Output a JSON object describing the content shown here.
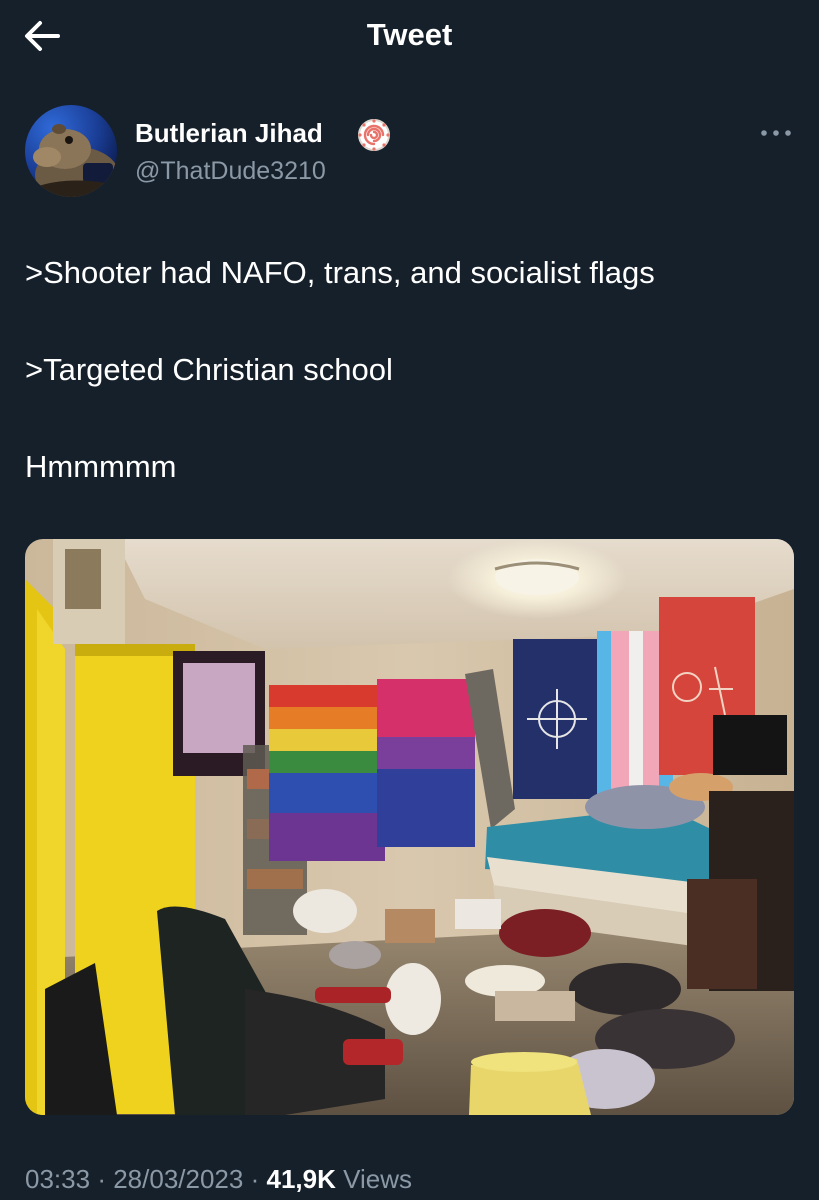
{
  "header": {
    "title": "Tweet",
    "back_icon": "back-arrow-icon"
  },
  "author": {
    "display_name": "Butlerian Jihad",
    "handle": "@ThatDude3210",
    "badge_icon": "naruto-swirl-badge-icon"
  },
  "tweet": {
    "lines": [
      ">Shooter had NAFO, trans, and socialist flags",
      ">Targeted Christian school",
      "Hmmmmm"
    ]
  },
  "media": {
    "kind": "photo",
    "description_icon": "bedroom-photo"
  },
  "meta": {
    "time": "03:33",
    "separator": "·",
    "date": "28/03/2023",
    "views_count": "41,9K",
    "views_label": "Views"
  },
  "colors": {
    "background": "#15202b",
    "secondary_text": "#8b98a5",
    "text": "#ffffff"
  }
}
